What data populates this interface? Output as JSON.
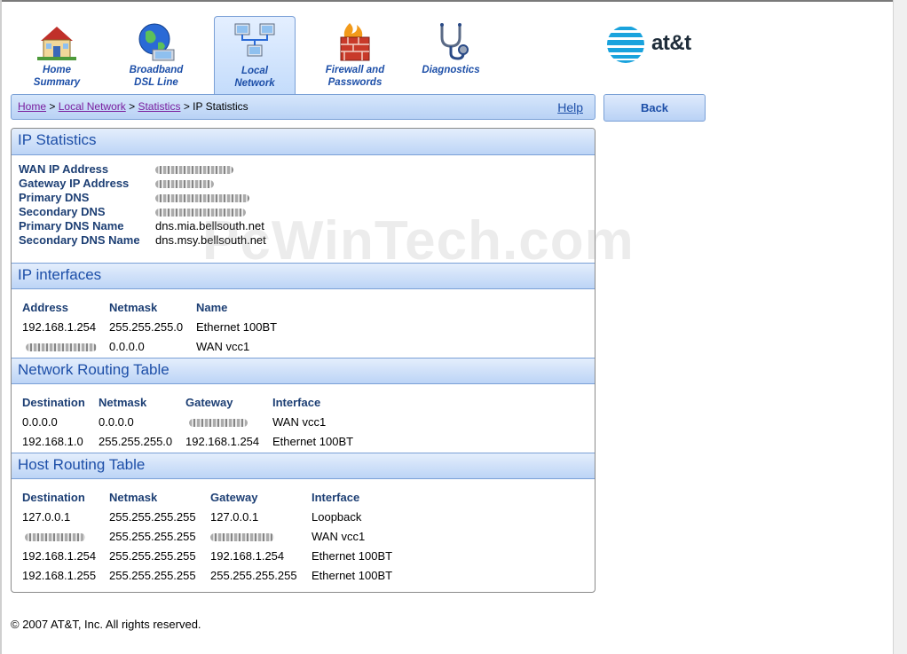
{
  "nav": {
    "tabs": [
      {
        "line1": "Home",
        "line2": "Summary",
        "icon": "house-icon"
      },
      {
        "line1": "Broadband",
        "line2": "DSL Line",
        "icon": "globe-icon"
      },
      {
        "line1": "Local",
        "line2": "Network",
        "icon": "network-icon"
      },
      {
        "line1": "Firewall and",
        "line2": "Passwords",
        "icon": "firewall-icon"
      },
      {
        "line1": "Diagnostics",
        "line2": "",
        "icon": "stethoscope-icon"
      }
    ],
    "active_tab": "Local Network",
    "brand": "at&t",
    "brand_color": "#1aa3dd",
    "accent_color": "#1d4fa8"
  },
  "breadcrumb": {
    "items": [
      "Home",
      "Local Network",
      "Statistics"
    ],
    "separator": ">",
    "current": "IP Statistics"
  },
  "help_label": "Help",
  "back_label": "Back",
  "ip_statistics": {
    "title": "IP Statistics",
    "rows": [
      {
        "label": "WAN IP Address",
        "value": ""
      },
      {
        "label": "Gateway IP Address",
        "value": ""
      },
      {
        "label": "Primary DNS",
        "value": ""
      },
      {
        "label": "Secondary DNS",
        "value": ""
      },
      {
        "label": "Primary DNS Name",
        "value": "dns.mia.bellsouth.net"
      },
      {
        "label": "Secondary DNS Name",
        "value": "dns.msy.bellsouth.net"
      }
    ]
  },
  "ip_interfaces": {
    "title": "IP interfaces",
    "headers": [
      "Address",
      "Netmask",
      "Name"
    ],
    "rows": [
      [
        "192.168.1.254",
        "255.255.255.0",
        "Ethernet 100BT"
      ],
      [
        "",
        "0.0.0.0",
        "WAN vcc1"
      ]
    ]
  },
  "network_routing": {
    "title": "Network Routing Table",
    "headers": [
      "Destination",
      "Netmask",
      "Gateway",
      "Interface"
    ],
    "rows": [
      [
        "0.0.0.0",
        "0.0.0.0",
        "",
        "WAN vcc1"
      ],
      [
        "192.168.1.0",
        "255.255.255.0",
        "192.168.1.254",
        "Ethernet 100BT"
      ]
    ]
  },
  "host_routing": {
    "title": "Host Routing Table",
    "headers": [
      "Destination",
      "Netmask",
      "Gateway",
      "Interface"
    ],
    "rows": [
      [
        "127.0.0.1",
        "255.255.255.255",
        "127.0.0.1",
        "Loopback"
      ],
      [
        "",
        "255.255.255.255",
        "",
        "WAN vcc1"
      ],
      [
        "192.168.1.254",
        "255.255.255.255",
        "192.168.1.254",
        "Ethernet 100BT"
      ],
      [
        "192.168.1.255",
        "255.255.255.255",
        "255.255.255.255",
        "Ethernet 100BT"
      ]
    ]
  },
  "footer": "© 2007 AT&T, Inc. All rights reserved.",
  "watermark": "PcWinTech.com"
}
